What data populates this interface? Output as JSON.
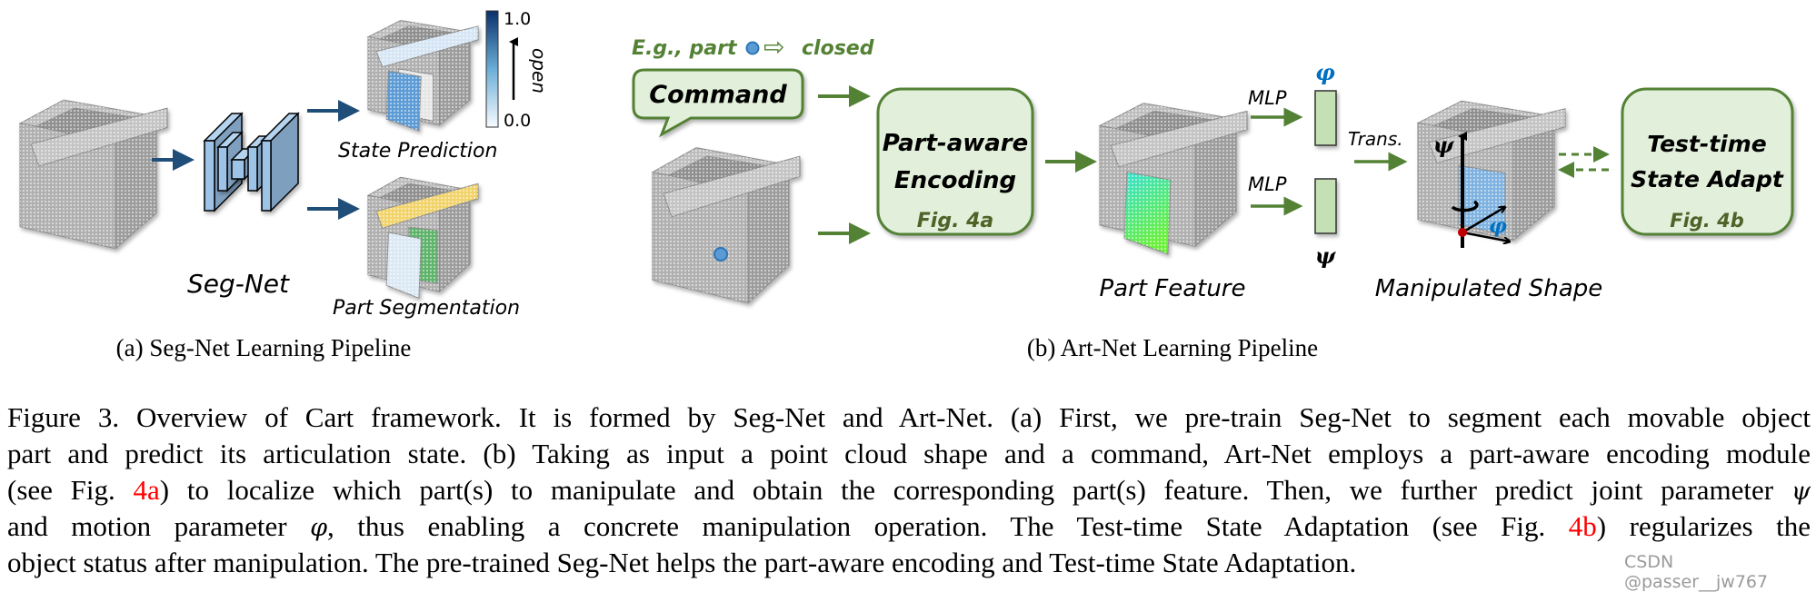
{
  "colors": {
    "green_arrow": "#548235",
    "box_fill": "#e2efda",
    "box_border": "#538135",
    "fig_ref_text": "#4f6228",
    "blue_arrow": "#1f4e79",
    "net_block": "#9dc3e6",
    "phi": "#0070c0",
    "caption_ref": "#ff0000",
    "state_open": "#5b9bd5",
    "seg_drawer": "#f2d36b",
    "seg_door_green": "#5fb36b",
    "seg_door_light": "#dbe9f5"
  },
  "panel_a": {
    "net_label": "Seg-Net",
    "state_label": "State Prediction",
    "seg_label": "Part Segmentation",
    "colorbar": {
      "max": "1.0",
      "min": "0.0",
      "label": "open"
    },
    "caption": "(a) Seg-Net Learning Pipeline"
  },
  "panel_b": {
    "example": {
      "prefix": "E.g., part",
      "arrow": "⇨",
      "suffix": "closed"
    },
    "command": "Command",
    "encoding": {
      "line1": "Part-aware",
      "line2": "Encoding",
      "ref": "Fig. 4a"
    },
    "mlp_top": "MLP",
    "mlp_bottom": "MLP",
    "phi": "φ",
    "psi": "ψ",
    "trans": "Trans.",
    "feature_label": "Part Feature",
    "manip_label": "Manipulated Shape",
    "axis_psi": "ψ",
    "axis_phi": "φ",
    "adapt": {
      "line1": "Test-time",
      "line2": "State Adapt",
      "ref": "Fig. 4b"
    },
    "caption": "(b) Art-Net Learning Pipeline"
  },
  "caption": {
    "line1": "Figure 3. Overview of Cart framework. It is formed by Seg-Net and Art-Net. (a) First, we pre-train Seg-Net to segment each movable object",
    "line2": "part and predict its articulation state. (b) Taking as input a point cloud shape and a command, Art-Net employs a part-aware encoding module",
    "line3": {
      "pre": "(see Fig. ",
      "ref": "4a",
      "post": ") to localize which part(s) to manipulate and obtain the corresponding part(s) feature. Then, we further predict joint parameter ",
      "sym": "ψ"
    },
    "line4": {
      "pre": "and motion parameter ",
      "sym": "φ",
      "mid": ", thus enabling a concrete manipulation operation. The Test-time State Adaptation (see Fig. ",
      "ref": "4b",
      "post": ") regularizes the"
    },
    "line5": "object status after manipulation. The pre-trained Seg-Net helps the part-aware encoding and Test-time State Adaptation."
  },
  "watermark": "CSDN @passer__jw767"
}
